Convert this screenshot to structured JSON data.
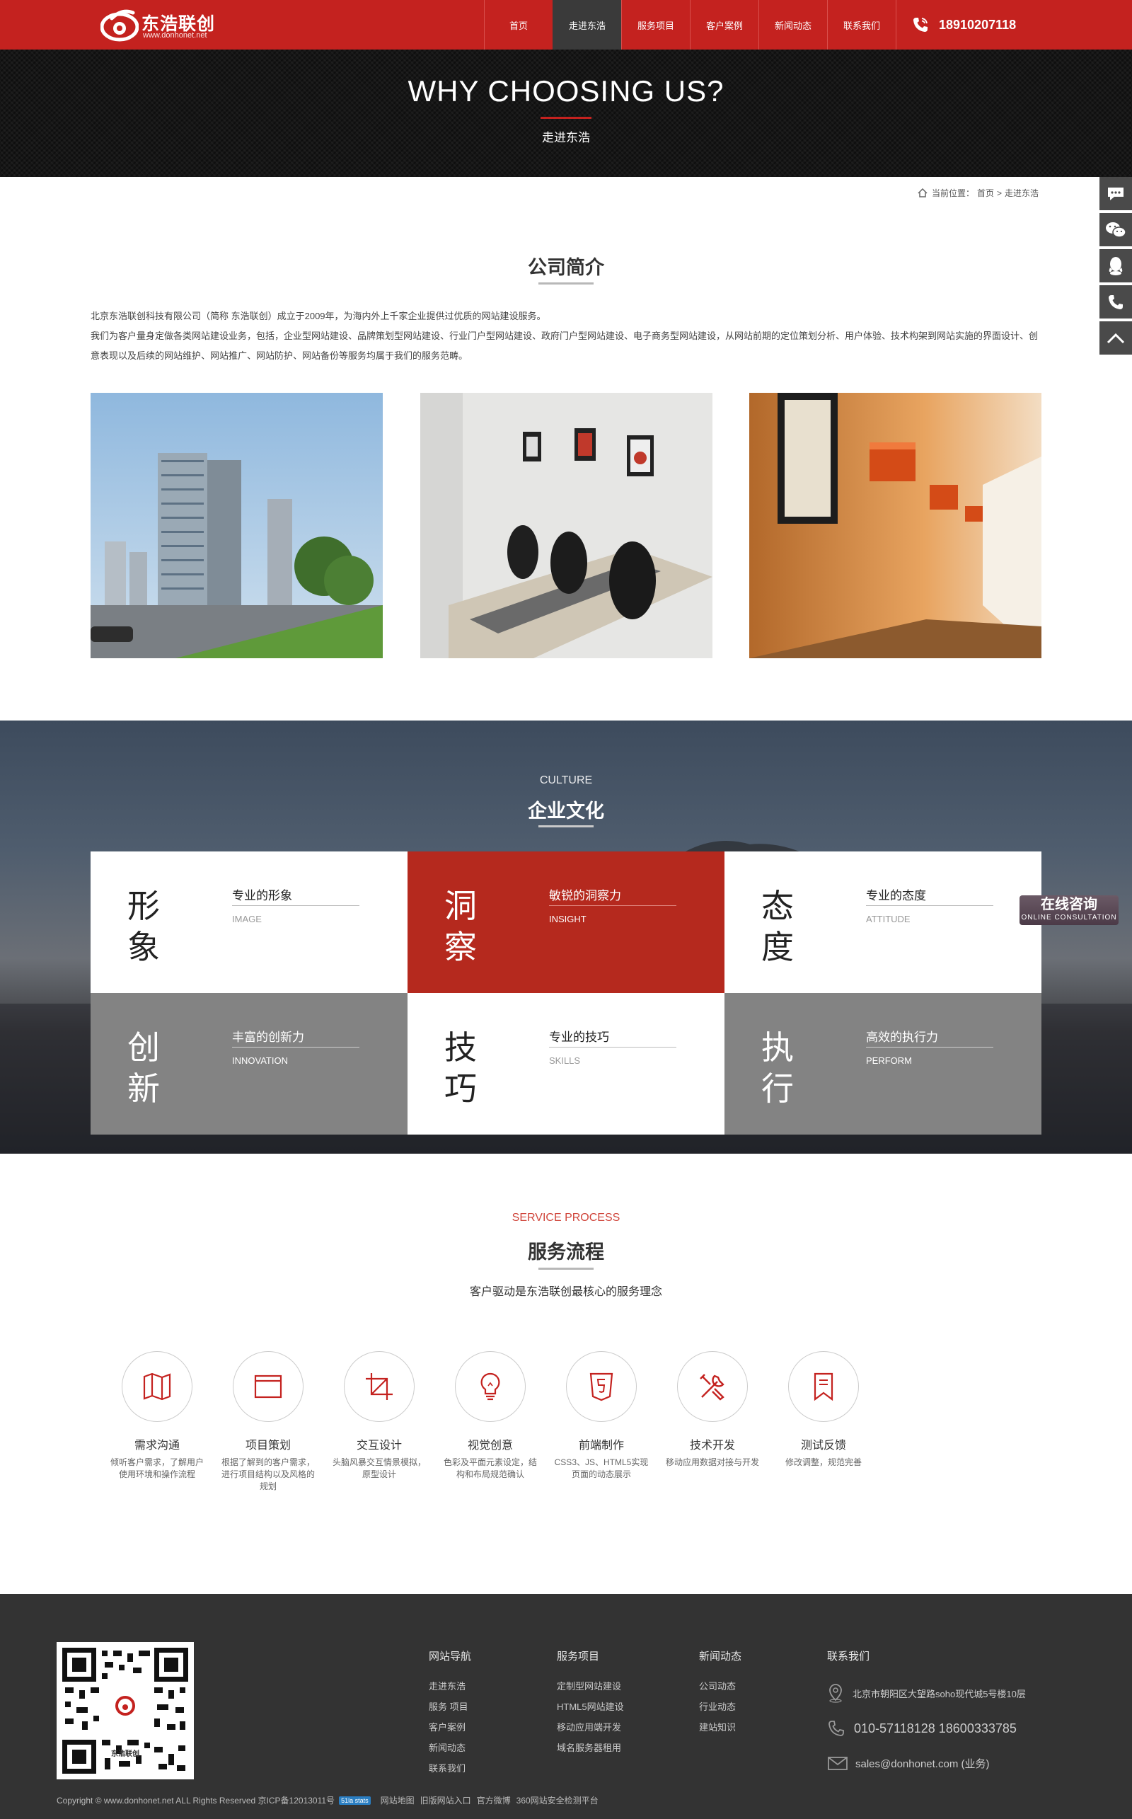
{
  "header": {
    "logo_name": "东浩联创",
    "logo_url": "www.donhonet.net",
    "nav": [
      {
        "label": "首页"
      },
      {
        "label": "走进东浩",
        "active": true
      },
      {
        "label": "服务项目"
      },
      {
        "label": "客户案例"
      },
      {
        "label": "新闻动态"
      },
      {
        "label": "联系我们"
      }
    ],
    "phone": "18910207118"
  },
  "banner": {
    "title": "WHY CHOOSING US?",
    "subtitle": "走进东浩"
  },
  "breadcrumb": {
    "prefix": "当前位置：",
    "home": "首页",
    "sep": ">",
    "current": "走进东浩"
  },
  "side_tools": [
    "chat-icon",
    "wechat-icon",
    "qq-icon",
    "phone-icon",
    "back-to-top-icon"
  ],
  "intro": {
    "title": "公司简介",
    "p1": "北京东浩联创科技有限公司（简称 东浩联创）成立于2009年，为海内外上千家企业提供过优质的网站建设服务。",
    "p2": "我们为客户量身定做各类网站建设业务，包括，企业型网站建设、品牌策划型网站建设、行业门户型网站建设、政府门户型网站建设、电子商务型网站建设，从网站前期的定位策划分析、用户体验、技术构架到网站实施的界面设计、创意表现以及后续的网站维护、网站推广、网站防护、网站备份等服务均属于我们的服务范畴。"
  },
  "culture": {
    "en": "CULTURE",
    "cn": "企业文化",
    "items": [
      {
        "big": "形象",
        "title": "专业的形象",
        "en": "IMAGE",
        "style": "white"
      },
      {
        "big": "洞察",
        "title": "敏锐的洞察力",
        "en": "INSIGHT",
        "style": "red"
      },
      {
        "big": "态度",
        "title": "专业的态度",
        "en": "ATTITUDE",
        "style": "white"
      },
      {
        "big": "创新",
        "title": "丰富的创新力",
        "en": "INNOVATION",
        "style": "gray"
      },
      {
        "big": "技巧",
        "title": "专业的技巧",
        "en": "SKILLS",
        "style": "white"
      },
      {
        "big": "执行",
        "title": "高效的执行力",
        "en": "PERFORM",
        "style": "gray"
      }
    ],
    "online_cn": "在线咨询",
    "online_en": "ONLINE CONSULTATION"
  },
  "process": {
    "en": "SERVICE PROCESS",
    "cn": "服务流程",
    "subtitle": "客户驱动是东浩联创最核心的服务理念",
    "steps": [
      {
        "icon": "map-icon",
        "name": "需求沟通",
        "desc": "倾听客户需求，了解用户使用环境和操作流程"
      },
      {
        "icon": "window-icon",
        "name": "项目策划",
        "desc": "根据了解到的客户需求，进行项目结构以及风格的规划"
      },
      {
        "icon": "crop-icon",
        "name": "交互设计",
        "desc": "头脑风暴交互情景模拟，原型设计"
      },
      {
        "icon": "bulb-icon",
        "name": "视觉创意",
        "desc": "色彩及平面元素设定，结构和布局规范确认"
      },
      {
        "icon": "html5-icon",
        "name": "前端制作",
        "desc": "CSS3、JS、HTML5实现页面的动态展示"
      },
      {
        "icon": "tools-icon",
        "name": "技术开发",
        "desc": "移动应用数据对接与开发"
      },
      {
        "icon": "bookmark-icon",
        "name": "测试反馈",
        "desc": "修改调整，规范完善"
      }
    ]
  },
  "footer": {
    "cols": [
      {
        "title": "网站导航",
        "links": [
          "走进东浩",
          "服务 项目",
          "客户案例",
          "新闻动态",
          "联系我们"
        ]
      },
      {
        "title": "服务项目",
        "links": [
          "定制型网站建设",
          "HTML5网站建设",
          "移动应用端开发",
          "域名服务器租用"
        ]
      },
      {
        "title": "新闻动态",
        "links": [
          "公司动态",
          "行业动态",
          "建站知识"
        ]
      }
    ],
    "contact_title": "联系我们",
    "address": "北京市朝阳区大望路soho现代城5号楼10层",
    "tel": "010-57118128 18600333785",
    "email": "sales@donhonet.com (业务)",
    "qr_label": "东浩联创",
    "copyright": "Copyright © www.donhonet.net ALL Rights Reserved 京ICP备12013011号",
    "badge": "51la stats",
    "links": [
      "网站地图",
      "旧版网站入口",
      "官方微博",
      "360网站安全检测平台"
    ]
  },
  "colors": {
    "brand_red": "#c4221f",
    "culture_red": "#b5291e",
    "footer_bg": "#333333"
  }
}
